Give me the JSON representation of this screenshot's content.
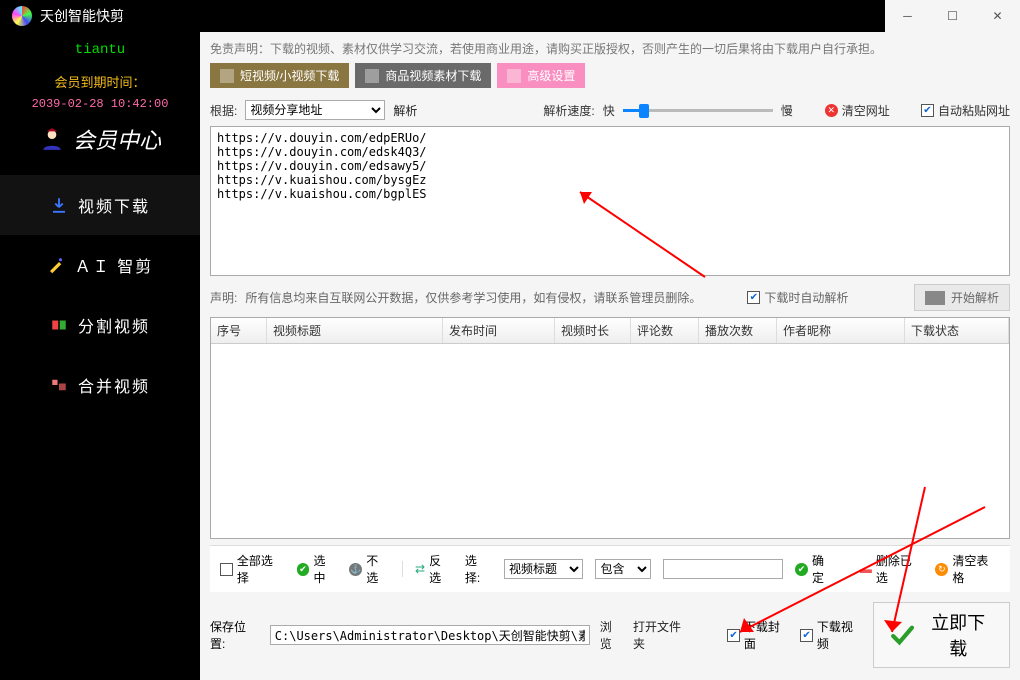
{
  "app": {
    "title": "天创智能快剪"
  },
  "sidebar": {
    "brand": "tiantu",
    "expire_label": "会员到期时间：",
    "expire_value": "2039-02-28 10:42:00",
    "member_center": "会员中心",
    "items": [
      {
        "label": "视频下载"
      },
      {
        "label": "ＡＩ 智剪"
      },
      {
        "label": "分割视频"
      },
      {
        "label": "合并视频"
      }
    ]
  },
  "top": {
    "disclaimer": "免责声明：下载的视频、素材仅供学习交流，若使用商业用途，请购买正版授权，否则产生的一切后果将由下载用户自行承担。",
    "tabs": {
      "short": "短视频/小视频下载",
      "product": "商品视频素材下载",
      "adv": "高级设置"
    }
  },
  "controls": {
    "root_lbl": "根据:",
    "root_combo": "视频分享地址",
    "parse": "解析",
    "speed_lbl": "解析速度:",
    "fast": "快",
    "slow": "慢",
    "clear_url": "清空网址",
    "auto_paste": "自动粘贴网址"
  },
  "urls": "https://v.douyin.com/edpERUo/\nhttps://v.douyin.com/edsk4Q3/\nhttps://v.douyin.com/edsawy5/\nhttps://v.kuaishou.com/bysgEz\nhttps://v.kuaishou.com/bgplES",
  "mid": {
    "note_lbl": "声明:",
    "note": "所有信息均来自互联网公开数据，仅供参考学习使用，如有侵权，请联系管理员删除。",
    "auto_parse": "下载时自动解析",
    "start_parse": "开始解析"
  },
  "grid": {
    "cols": [
      "序号",
      "视频标题",
      "发布时间",
      "视频时长",
      "评论数",
      "播放次数",
      "作者昵称",
      "下载状态"
    ]
  },
  "footer1": {
    "select_all": "全部选择",
    "select": "选中",
    "unselect": "不选",
    "invert": "反选",
    "choose_lbl": "选择:",
    "field_combo": "视频标题",
    "op_combo": "包含",
    "confirm": "确定",
    "del_sel": "删除已选",
    "clear_tbl": "清空表格"
  },
  "footer2": {
    "path_lbl": "保存位置:",
    "path": "C:\\Users\\Administrator\\Desktop\\天创智能快剪\\素材",
    "browse": "浏览",
    "openf": "打开文件夹",
    "dl_cover": "下载封面",
    "dl_video": "下载视频",
    "go": "立即下载"
  }
}
